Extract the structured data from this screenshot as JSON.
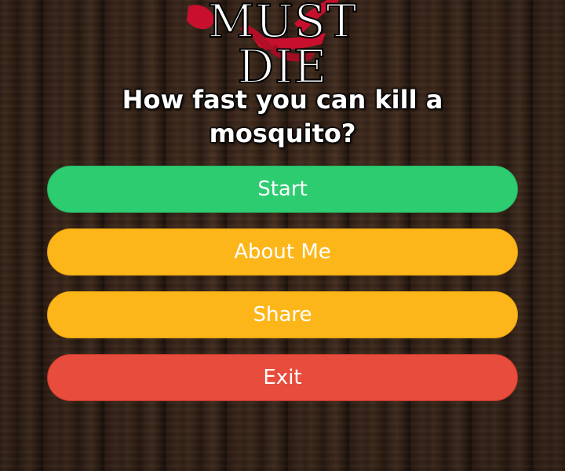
{
  "logo": {
    "text": "MUST DIE",
    "splat_color": "#c8102e"
  },
  "headline": {
    "line1": "How fast you can kill a",
    "line2": "mosquito?"
  },
  "menu": {
    "start_label": "Start",
    "about_label": "About Me",
    "share_label": "Share",
    "exit_label": "Exit"
  },
  "colors": {
    "start": "#2ecc71",
    "about": "#fdb619",
    "share": "#fdb619",
    "exit": "#e74c3c"
  }
}
